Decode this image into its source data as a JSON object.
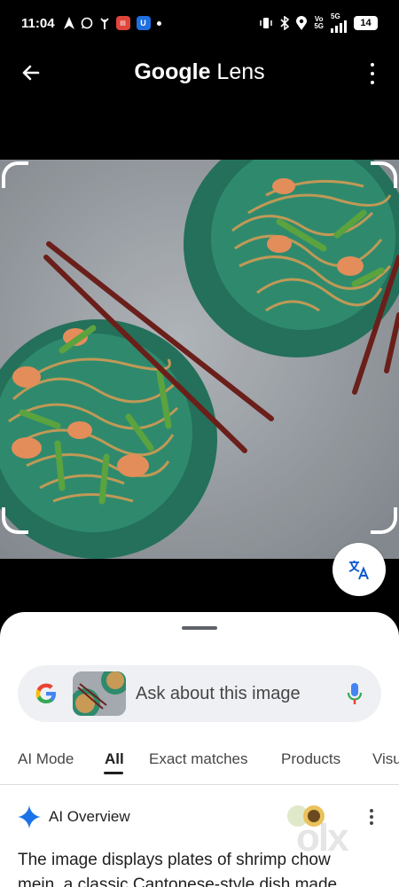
{
  "status_bar": {
    "time": "11:04",
    "battery": "14",
    "network_label_top": "Vo",
    "network_label_bottom": "5G",
    "network_label_5g": "5G",
    "icons": [
      "navigation-icon",
      "whatsapp-icon",
      "hotspot-icon",
      "news-app-icon",
      "shield-app-icon",
      "dot-icon",
      "vibrate-icon",
      "bluetooth-icon",
      "location-icon",
      "signal-icon",
      "battery-icon"
    ]
  },
  "app_bar": {
    "title_brand": "Google",
    "title_product": "Lens"
  },
  "search": {
    "placeholder": "Ask about this image"
  },
  "tabs": [
    {
      "label": "AI Mode"
    },
    {
      "label": "All",
      "active": true
    },
    {
      "label": "Exact matches"
    },
    {
      "label": "Products"
    },
    {
      "label": "Visu"
    }
  ],
  "ai_overview": {
    "title": "AI Overview",
    "line1": "The image displays plates of shrimp chow",
    "line2": "mein, a classic Cantonese-style dish made"
  },
  "watermark": "olx",
  "colors": {
    "plate": "#2f8a6d",
    "background": "#000000",
    "sheet": "#ffffff",
    "accent_blue": "#1a73e8"
  }
}
